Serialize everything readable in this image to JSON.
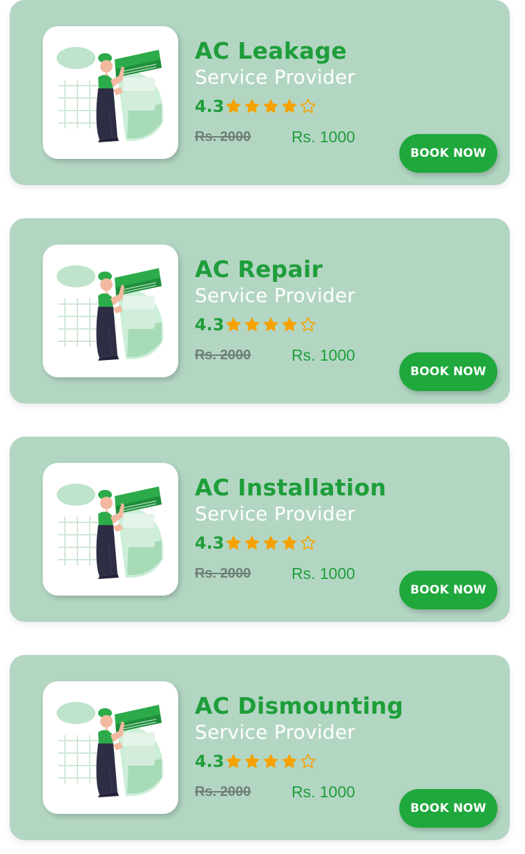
{
  "colors": {
    "card_background": "#b3d6c3",
    "accent_green": "#1e9e3a",
    "button_green": "#1fa83c",
    "star_orange": "#f5a201",
    "subtitle_white": "#ffffff"
  },
  "services": [
    {
      "title": "AC Leakage",
      "subtitle": "Service Provider",
      "rating": "4.3",
      "stars_filled": 4,
      "stars_total": 5,
      "old_price": "Rs. 2000",
      "new_price": "Rs. 1000",
      "button_label": "BOOK NOW",
      "image_icon": "technician-ac-illustration"
    },
    {
      "title": "AC Repair",
      "subtitle": "Service Provider",
      "rating": "4.3",
      "stars_filled": 4,
      "stars_total": 5,
      "old_price": "Rs. 2000",
      "new_price": "Rs. 1000",
      "button_label": "BOOK NOW",
      "image_icon": "technician-ac-illustration"
    },
    {
      "title": "AC Installation",
      "subtitle": "Service Provider",
      "rating": "4.3",
      "stars_filled": 4,
      "stars_total": 5,
      "old_price": "Rs. 2000",
      "new_price": "Rs. 1000",
      "button_label": "BOOK NOW",
      "image_icon": "technician-ac-illustration"
    },
    {
      "title": "AC Dismounting",
      "subtitle": "Service Provider",
      "rating": "4.3",
      "stars_filled": 4,
      "stars_total": 5,
      "old_price": "Rs. 2000",
      "new_price": "Rs. 1000",
      "button_label": "BOOK NOW",
      "image_icon": "technician-ac-illustration"
    }
  ]
}
